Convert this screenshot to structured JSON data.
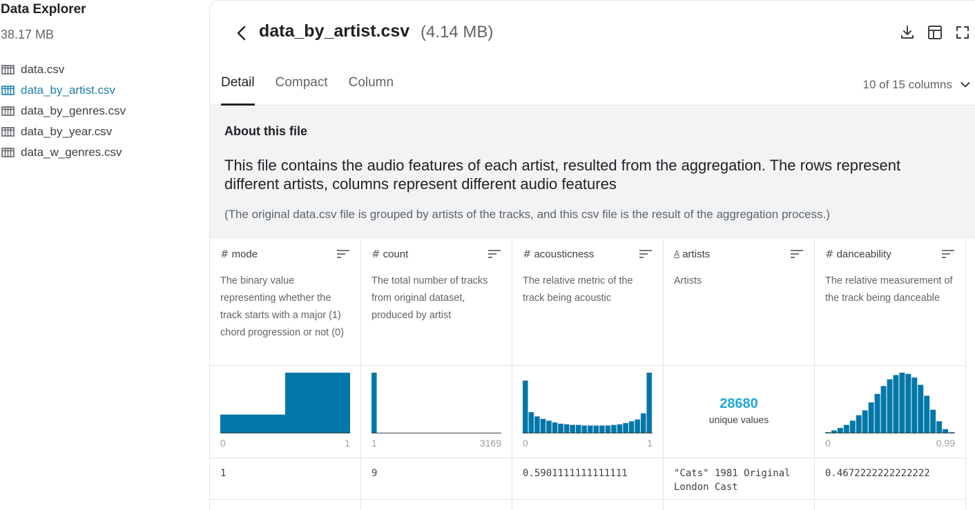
{
  "sidebar": {
    "title": "Data Explorer",
    "size": "38.17 MB",
    "files": [
      {
        "label": "data.csv"
      },
      {
        "label": "data_by_artist.csv"
      },
      {
        "label": "data_by_genres.csv"
      },
      {
        "label": "data_by_year.csv"
      },
      {
        "label": "data_w_genres.csv"
      }
    ],
    "active_index": 1
  },
  "header": {
    "file_name": "data_by_artist.csv",
    "file_size": "(4.14 MB)",
    "icons": [
      "download-icon",
      "table-view-icon",
      "fullscreen-icon"
    ]
  },
  "tabs": [
    "Detail",
    "Compact",
    "Column"
  ],
  "active_tab": "Detail",
  "column_count": "10 of 15 columns",
  "about": {
    "heading": "About this file",
    "description": "This file contains the audio features of each artist, resulted from the aggregation. The rows represent different artists, columns represent different audio features",
    "note": "(The original data.csv file is grouped by artists of the tracks, and this csv file is the result of the aggregation process.)"
  },
  "colors": {
    "bar": "#0377a8",
    "unique": "#20a7d8",
    "active_link": "#1a7fa8"
  },
  "columns": [
    {
      "type_icon": "#",
      "name": "mode",
      "description": "The binary value representing whether the track starts with a major (1) chord progression or not (0)",
      "axis_min": "0",
      "axis_max": "1",
      "histogram": [
        0.31,
        1.0
      ],
      "first_value": "1"
    },
    {
      "type_icon": "#",
      "name": "count",
      "description": "The total number of tracks from original dataset, produced by artist",
      "axis_min": "1",
      "axis_max": "3169",
      "histogram": [
        1.0,
        0.0,
        0.0,
        0.0,
        0.0,
        0.0,
        0.0,
        0.0,
        0.0,
        0.0,
        0.0,
        0.0,
        0.0,
        0.0,
        0.0,
        0.0,
        0.0,
        0.0,
        0.0,
        0.0,
        0.0,
        0.0
      ],
      "first_value": "9"
    },
    {
      "type_icon": "#",
      "name": "acousticness",
      "description": "The relative metric of the track being acoustic",
      "axis_min": "0",
      "axis_max": "1",
      "histogram": [
        0.87,
        0.35,
        0.28,
        0.24,
        0.21,
        0.18,
        0.16,
        0.15,
        0.14,
        0.14,
        0.13,
        0.13,
        0.13,
        0.13,
        0.13,
        0.14,
        0.15,
        0.17,
        0.2,
        0.23,
        0.33,
        1.0
      ],
      "first_value": "0.5901111111111111"
    },
    {
      "type_icon": "A",
      "name": "artists",
      "description": "Artists",
      "unique_count": "28680",
      "unique_label": "unique values",
      "first_value": "\"Cats\" 1981 Original London Cast"
    },
    {
      "type_icon": "#",
      "name": "danceability",
      "description": "The relative measurement of the track being danceable",
      "axis_min": "0",
      "axis_max": "0.99",
      "histogram": [
        0.02,
        0.05,
        0.09,
        0.14,
        0.21,
        0.3,
        0.38,
        0.51,
        0.65,
        0.78,
        0.89,
        0.96,
        1.0,
        0.98,
        0.92,
        0.8,
        0.62,
        0.39,
        0.2,
        0.07,
        0.02
      ],
      "first_value": "0.4672222222222222"
    }
  ]
}
